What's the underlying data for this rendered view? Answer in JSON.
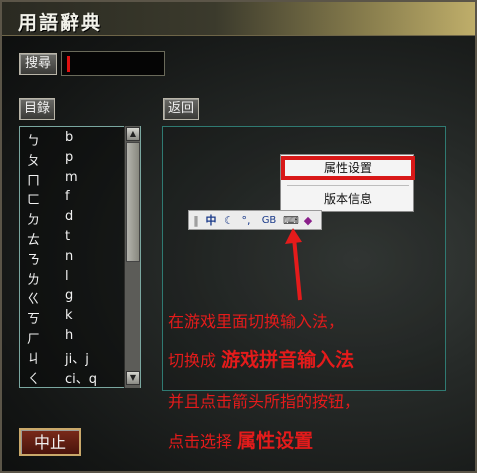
{
  "window": {
    "title": "用語辭典"
  },
  "search": {
    "button_label": "搜尋",
    "value": ""
  },
  "index": {
    "tab_label": "目錄"
  },
  "back_button": {
    "label": "返回"
  },
  "list": {
    "items": [
      {
        "symbol": "ㄅ",
        "pinyin": "b"
      },
      {
        "symbol": "ㄆ",
        "pinyin": "p"
      },
      {
        "symbol": "ㄇ",
        "pinyin": "m"
      },
      {
        "symbol": "ㄈ",
        "pinyin": "f"
      },
      {
        "symbol": "ㄉ",
        "pinyin": "d"
      },
      {
        "symbol": "ㄊ",
        "pinyin": "t"
      },
      {
        "symbol": "ㄋ",
        "pinyin": "n"
      },
      {
        "symbol": "ㄌ",
        "pinyin": "l"
      },
      {
        "symbol": "ㄍ",
        "pinyin": "g"
      },
      {
        "symbol": "ㄎ",
        "pinyin": "k"
      },
      {
        "symbol": "ㄏ",
        "pinyin": "h"
      },
      {
        "symbol": "ㄐ",
        "pinyin": "ji、j"
      },
      {
        "symbol": "ㄑ",
        "pinyin": "ci、q"
      }
    ]
  },
  "ime_menu": {
    "item_properties": "属性设置",
    "item_version": "版本信息"
  },
  "ime_toolbar": {
    "icons": [
      "separator-icon",
      "chinese-mode-icon",
      "moon-icon",
      "punctuation-icon",
      "gb-icon",
      "keyboard-icon",
      "book-icon"
    ],
    "labels": {
      "cn": "中",
      "gb": "GB"
    }
  },
  "instructions": {
    "line1": "在游戏里面切换输入法，",
    "line2_prefix": "切换成",
    "line2_emphasis": "游戏拼音输入法",
    "line3": "并且点击箭头所指的按钮，",
    "line4_prefix": "点击选择",
    "line4_emphasis": "属性设置"
  },
  "stop_button": {
    "label": "中止"
  },
  "colors": {
    "annotation_red": "#e41b1b",
    "panel_border": "#2f7a72"
  }
}
